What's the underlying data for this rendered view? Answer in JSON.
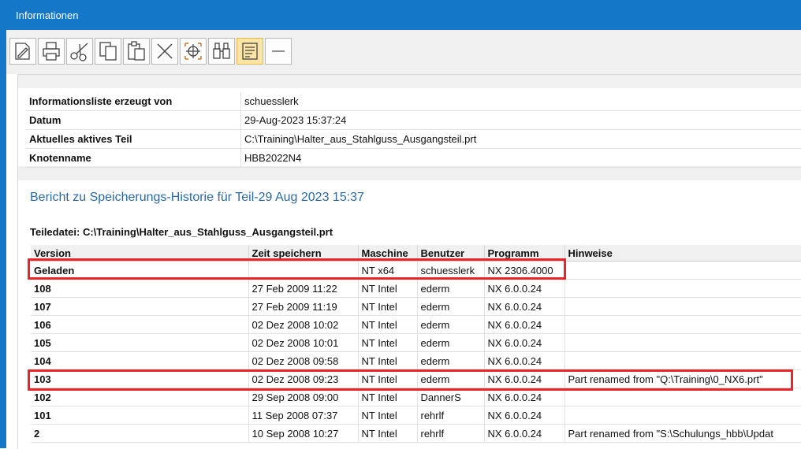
{
  "window": {
    "title": "Informationen"
  },
  "toolbar": {
    "buttons": [
      {
        "icon": "edit-document-icon"
      },
      {
        "icon": "print-icon"
      },
      {
        "icon": "cut-icon"
      },
      {
        "icon": "copy-icon"
      },
      {
        "icon": "paste-icon"
      },
      {
        "icon": "delete-icon"
      },
      {
        "icon": "crosshair-icon"
      },
      {
        "icon": "binoculars-icon"
      },
      {
        "icon": "wrap-text-icon"
      },
      {
        "icon": "minus-icon"
      }
    ]
  },
  "info": {
    "rows": [
      {
        "key": "Informationsliste erzeugt von",
        "value": "schuesslerk"
      },
      {
        "key": "Datum",
        "value": "29-Aug-2023 15:37:24"
      },
      {
        "key": "Aktuelles aktives Teil",
        "value": "C:\\Training\\Halter_aus_Stahlguss_Ausgangsteil.prt"
      },
      {
        "key": "Knotenname",
        "value": "HBB2022N4"
      }
    ]
  },
  "report": {
    "title": "Bericht zu Speicherungs-Historie für Teil-29 Aug 2023 15:37",
    "file_label": "Teiledatei: C:\\Training\\Halter_aus_Stahlguss_Ausgangsteil.prt",
    "columns": [
      "Version",
      "Zeit speichern",
      "Maschine",
      "Benutzer",
      "Programm",
      "Hinweise"
    ],
    "rows": [
      [
        "Geladen",
        "",
        "NT x64",
        "schuesslerk",
        "NX 2306.4000",
        ""
      ],
      [
        "108",
        "27 Feb 2009 11:22",
        "NT Intel",
        "ederm",
        "NX 6.0.0.24",
        ""
      ],
      [
        "107",
        "27 Feb 2009 11:19",
        "NT Intel",
        "ederm",
        "NX 6.0.0.24",
        ""
      ],
      [
        "106",
        "02 Dez 2008 10:02",
        "NT Intel",
        "ederm",
        "NX 6.0.0.24",
        ""
      ],
      [
        "105",
        "02 Dez 2008 10:01",
        "NT Intel",
        "ederm",
        "NX 6.0.0.24",
        ""
      ],
      [
        "104",
        "02 Dez 2008 09:58",
        "NT Intel",
        "ederm",
        "NX 6.0.0.24",
        ""
      ],
      [
        "103",
        "02 Dez 2008 09:23",
        "NT Intel",
        "ederm",
        "NX 6.0.0.24",
        "Part renamed from \"Q:\\Training\\0_NX6.prt\""
      ],
      [
        "102",
        "29 Sep 2008 09:00",
        "NT Intel",
        "DannerS",
        "NX 6.0.0.24",
        ""
      ],
      [
        "101",
        "11 Sep 2008 07:37",
        "NT Intel",
        "rehrlf",
        "NX 6.0.0.24",
        ""
      ],
      [
        "2",
        "10 Sep 2008 10:27",
        "NT Intel",
        "rehrlf",
        "NX 6.0.0.24",
        "Part renamed from \"S:\\Schulungs_hbb\\Updat"
      ]
    ]
  },
  "colors": {
    "titlebar": "#1477c8",
    "highlight": "#e8262a",
    "report_title": "#2b6aa3"
  }
}
